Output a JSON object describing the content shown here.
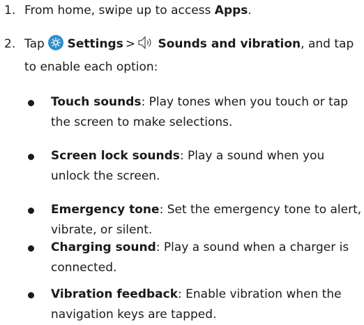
{
  "steps": [
    {
      "number": "1.",
      "prefix": "From home, swipe up to access ",
      "bold": "Apps",
      "suffix": "."
    },
    {
      "number": "2.",
      "tap": "Tap",
      "settings_label": "Settings",
      "separator": ">",
      "sounds_label": "Sounds and vibration",
      "suffix": ", and tap to enable each option:",
      "settings_icon": "gear-icon",
      "sounds_icon": "speaker-icon",
      "settings_icon_color": "#2f8fce"
    }
  ],
  "options": [
    {
      "title": "Touch sounds",
      "sep": ":",
      "desc": " Play tones when you touch or tap the screen to make selections."
    },
    {
      "title": "Screen lock sounds",
      "sep": ":",
      "desc": " Play a sound when you unlock the screen."
    },
    {
      "title": "Emergency tone",
      "sep": ":",
      "desc": " Set the emergency tone to alert, vibrate, or silent."
    },
    {
      "title": "Charging sound",
      "sep": ":",
      "desc": " Play a sound when a charger is connected."
    },
    {
      "title": "Vibration feedback",
      "sep": ":",
      "desc": " Enable vibration when the navigation keys are tapped."
    }
  ]
}
